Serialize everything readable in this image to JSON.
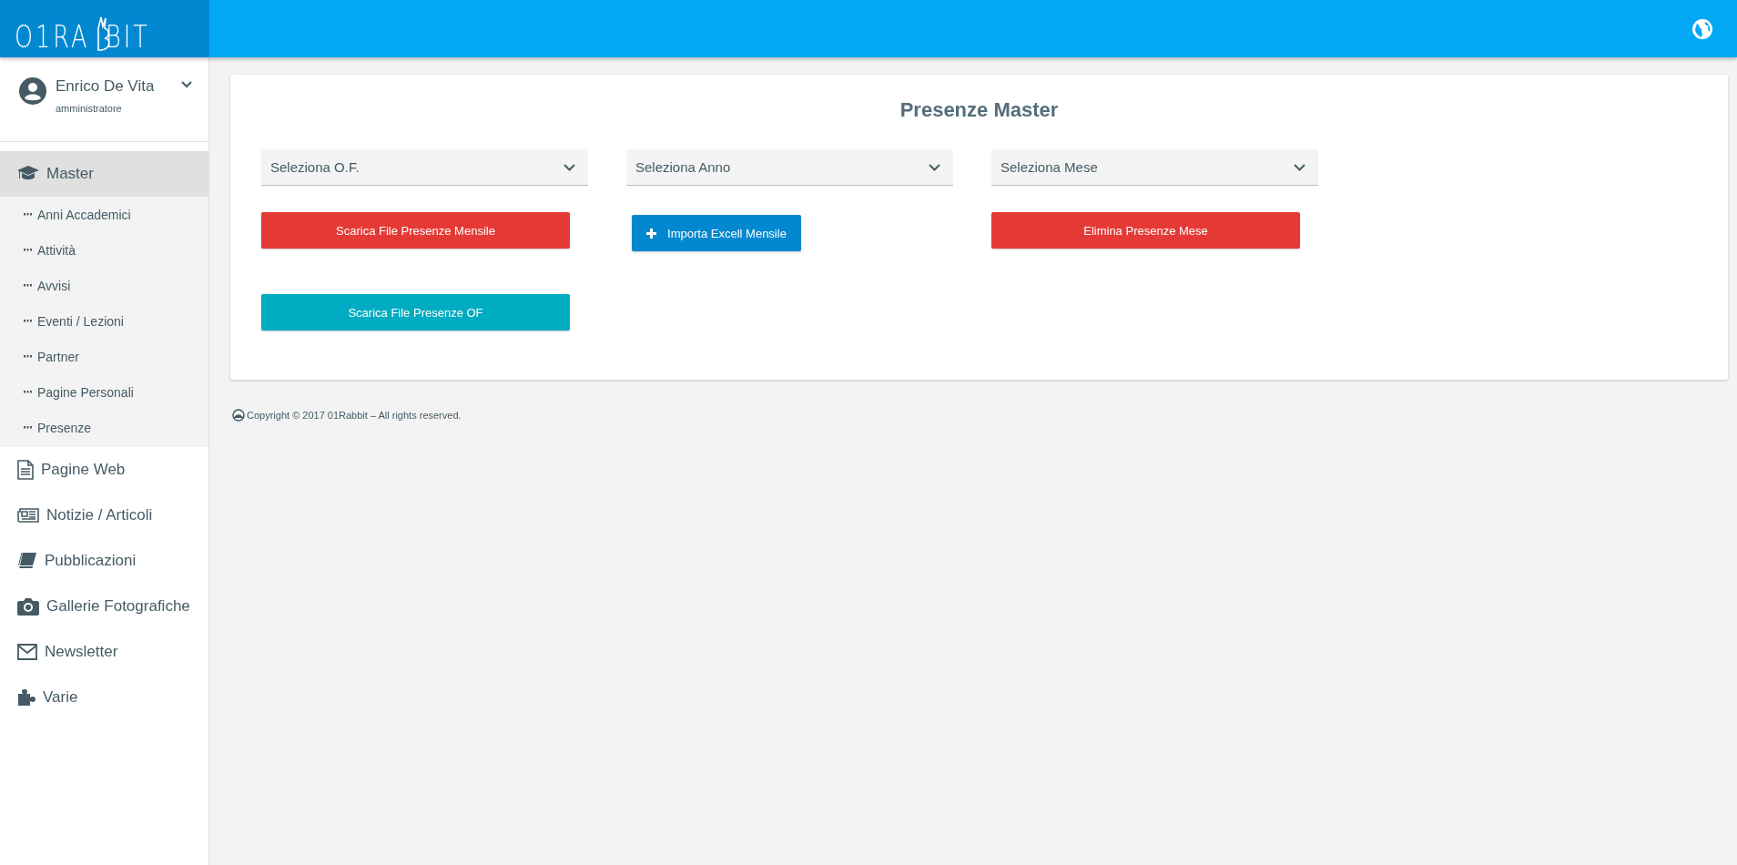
{
  "logo": {
    "before": "O1RA",
    "after": "BIT"
  },
  "user": {
    "name": "Enrico De Vita",
    "role": "amministratore",
    "expanded": false
  },
  "sidebar": {
    "items": [
      {
        "label": "Master",
        "selected": true,
        "expanded": true,
        "children": [
          {
            "label": "Anni Accademici",
            "selected": false
          },
          {
            "label": "Attività",
            "selected": false
          },
          {
            "label": "Avvisi",
            "selected": false
          },
          {
            "label": "Eventi / Lezioni",
            "selected": false
          },
          {
            "label": "Partner",
            "selected": false
          },
          {
            "label": "Pagine Personali",
            "selected": false
          },
          {
            "label": "Presenze",
            "selected": false
          }
        ]
      },
      {
        "label": "Pagine Web",
        "selected": false
      },
      {
        "label": "Notizie / Articoli",
        "selected": false
      },
      {
        "label": "Pubblicazioni",
        "selected": false
      },
      {
        "label": "Gallerie Fotografiche",
        "selected": false
      },
      {
        "label": "Newsletter",
        "selected": false
      },
      {
        "label": "Varie",
        "selected": false
      }
    ]
  },
  "card": {
    "title": "Presenze Master",
    "selects": [
      {
        "placeholder": "Seleziona O.F."
      },
      {
        "placeholder": "Seleziona Anno"
      },
      {
        "placeholder": "Seleziona Mese"
      }
    ],
    "buttons": [
      {
        "label": "Scarica File Presenze Mensile",
        "kind": "danger"
      },
      {
        "label": "Importa Excell Mensile",
        "kind": "primary"
      },
      {
        "label": "Elimina Presenze Mese",
        "kind": "danger"
      },
      {
        "label": "Scarica File Presenze OF",
        "kind": "info"
      }
    ]
  },
  "footer": {
    "text": "Copyright © 2017 01Rabbit – All rights reserved."
  }
}
